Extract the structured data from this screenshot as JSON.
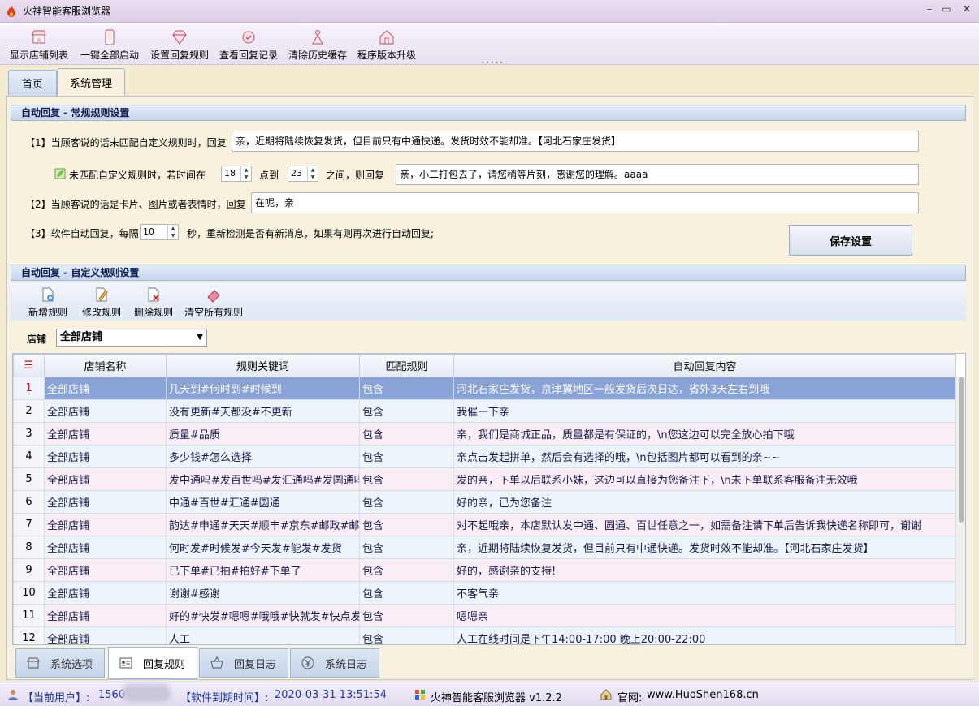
{
  "window": {
    "title": "火神智能客服浏览器",
    "minimize": "–",
    "maximize": "▭",
    "close": "✕"
  },
  "toolbar": [
    {
      "label": "显示店铺列表",
      "icon": "store-icon"
    },
    {
      "label": "一键全部启动",
      "icon": "phone-icon"
    },
    {
      "label": "设置回复规则",
      "icon": "diamond-icon"
    },
    {
      "label": "查看回复记录",
      "icon": "badge-icon"
    },
    {
      "label": "清除历史缓存",
      "icon": "broom-icon"
    },
    {
      "label": "程序版本升级",
      "icon": "house-icon"
    }
  ],
  "tabs": [
    {
      "label": "首页"
    },
    {
      "label": "系统管理"
    }
  ],
  "general": {
    "header": "自动回复 - 常规规则设置",
    "rule1_label": "【1】当顾客说的话未匹配自定义规则时，回复",
    "rule1_value": "亲，近期将陆续恢复发货，但目前只有中通快递。发货时效不能却准。【河北石家庄发货】",
    "time_label_a": "未匹配自定义规则时，若时间在",
    "time_from": "18",
    "time_label_b": "点到",
    "time_to": "23",
    "time_label_c": "之间，则回复",
    "time_reply": "亲，小二打包去了，请您稍等片刻，感谢您的理解。aaaa",
    "rule2_label": "【2】当顾客说的话是卡片、图片或者表情时，回复",
    "rule2_value": "在呢，亲",
    "rule3_label_a": "【3】软件自动回复，每隔",
    "interval": "10",
    "rule3_label_b": "秒，重新检测是否有新消息，如果有则再次进行自动回复;",
    "save_label": "保存设置"
  },
  "custom": {
    "header": "自动回复 - 自定义规则设置",
    "buttons": [
      {
        "label": "新增规则",
        "icon": "add-rule-icon"
      },
      {
        "label": "修改规则",
        "icon": "edit-rule-icon"
      },
      {
        "label": "删除规则",
        "icon": "delete-rule-icon"
      },
      {
        "label": "清空所有规则",
        "icon": "eraser-icon"
      }
    ],
    "shop_label": "店铺",
    "shop_selected": "全部店铺"
  },
  "table": {
    "menu_icon": "☰",
    "columns": [
      "店铺名称",
      "规则关键词",
      "匹配规则",
      "自动回复内容"
    ],
    "rows": [
      {
        "n": "1",
        "shop": "全部店铺",
        "keywords": "几天到#何时到#时候到",
        "match": "包含",
        "reply": "河北石家庄发货，京津冀地区一般发货后次日达，省外3天左右到哦"
      },
      {
        "n": "2",
        "shop": "全部店铺",
        "keywords": "没有更新#天都没#不更新",
        "match": "包含",
        "reply": "我催一下亲"
      },
      {
        "n": "3",
        "shop": "全部店铺",
        "keywords": "质量#品质",
        "match": "包含",
        "reply": "亲，我们是商城正品，质量都是有保证的，\\n您这边可以完全放心拍下哦"
      },
      {
        "n": "4",
        "shop": "全部店铺",
        "keywords": "多少钱#怎么选择",
        "match": "包含",
        "reply": "亲点击发起拼单，然后会有选择的哦，\\n包括图片都可以看到的亲~~"
      },
      {
        "n": "5",
        "shop": "全部店铺",
        "keywords": "发中通吗#发百世吗#发汇通吗#发圆通吗",
        "match": "包含",
        "reply": "发的亲，下单以后联系小妹，这边可以直接为您备注下，\\n未下单联系客服备注无效哦"
      },
      {
        "n": "6",
        "shop": "全部店铺",
        "keywords": "中通#百世#汇通#圆通",
        "match": "包含",
        "reply": "好的亲，已为您备注"
      },
      {
        "n": "7",
        "shop": "全部店铺",
        "keywords": "韵达#申通#天天#顺丰#京东#邮政#邮局",
        "match": "包含",
        "reply": "对不起哦亲，本店默认发中通、圆通、百世任意之一，如需备注请下单后告诉我快递名称即可，谢谢"
      },
      {
        "n": "8",
        "shop": "全部店铺",
        "keywords": "何时发#时候发#今天发#能发#发货",
        "match": "包含",
        "reply": "亲，近期将陆续恢复发货，但目前只有中通快递。发货时效不能却准。【河北石家庄发货】"
      },
      {
        "n": "9",
        "shop": "全部店铺",
        "keywords": "已下单#已拍#拍好#下单了",
        "match": "包含",
        "reply": "好的，感谢亲的支持!"
      },
      {
        "n": "10",
        "shop": "全部店铺",
        "keywords": "谢谢#感谢",
        "match": "包含",
        "reply": "不客气亲"
      },
      {
        "n": "11",
        "shop": "全部店铺",
        "keywords": "好的#快发#嗯嗯#哦哦#快就发#快点发#",
        "match": "包含",
        "reply": "嗯嗯亲"
      },
      {
        "n": "12",
        "shop": "全部店铺",
        "keywords": "人工",
        "match": "包含",
        "reply": "人工在线时间是下午14:00-17:00 晚上20:00-22:00"
      }
    ]
  },
  "bottom_tabs": [
    {
      "label": "系统选项",
      "icon": "store-icon"
    },
    {
      "label": "回复规则",
      "icon": "rules-icon"
    },
    {
      "label": "回复日志",
      "icon": "basket-icon"
    },
    {
      "label": "系统日志",
      "icon": "yen-icon"
    }
  ],
  "status": {
    "user_label": "【当前用户】:",
    "user_value": "1560",
    "expire_label": "【软件到期时间】:",
    "expire_value": "2020-03-31 13:51:54",
    "app": "火神智能客服浏览器 v1.2.2",
    "site_label": "官网:",
    "site_value": "www.HuoShen168.cn"
  }
}
